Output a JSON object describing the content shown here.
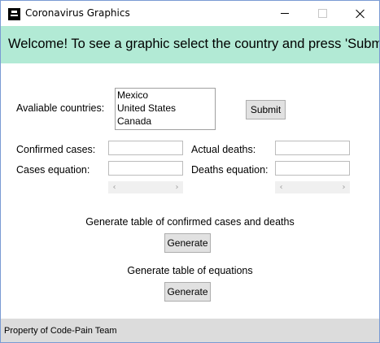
{
  "window": {
    "title": "Coronavirus Graphics",
    "icon": "app-icon",
    "controls": {
      "minimize": "minimize-icon",
      "maximize": "maximize-icon",
      "close": "close-icon"
    }
  },
  "banner": {
    "text": "Welcome! To see a graphic select the country and press 'Submit'.",
    "background": "#b2ead5"
  },
  "countries": {
    "label": "Avaliable countries:",
    "options": [
      "Mexico",
      "United States",
      "Canada"
    ],
    "submit_label": "Submit"
  },
  "fields": {
    "confirmed_cases_label": "Confirmed cases:",
    "confirmed_cases_value": "",
    "cases_equation_label": "Cases equation:",
    "cases_equation_value": "",
    "actual_deaths_label": "Actual deaths:",
    "actual_deaths_value": "",
    "deaths_equation_label": "Deaths equation:",
    "deaths_equation_value": ""
  },
  "scrollbars": {
    "left_arrow": "‹",
    "right_arrow": "›"
  },
  "generate_table": {
    "label": "Generate table of confirmed cases and deaths",
    "button_label": "Generate"
  },
  "generate_equations": {
    "label": "Generate table of equations",
    "button_label": "Generate"
  },
  "status_bar": {
    "text": "Property of Code-Pain Team"
  }
}
